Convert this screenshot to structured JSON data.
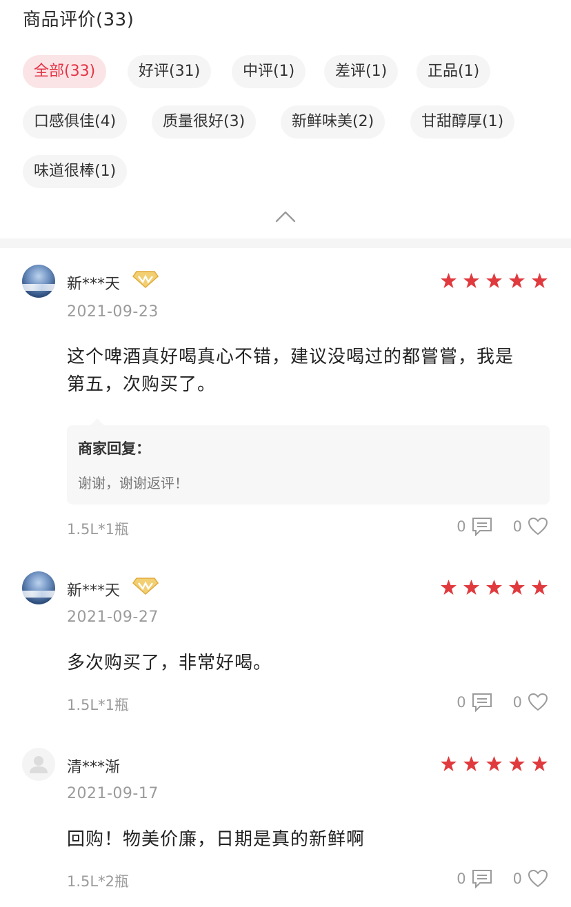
{
  "header": {
    "title": "商品评价(33)"
  },
  "tags": [
    {
      "label": "全部(33)",
      "active": true
    },
    {
      "label": "好评(31)",
      "active": false
    },
    {
      "label": "中评(1)",
      "active": false
    },
    {
      "label": "差评(1)",
      "active": false
    },
    {
      "label": "正品(1)",
      "active": false
    },
    {
      "label": "口感俱佳(4)",
      "active": false
    },
    {
      "label": "质量很好(3)",
      "active": false
    },
    {
      "label": "新鲜味美(2)",
      "active": false
    },
    {
      "label": "甘甜醇厚(1)",
      "active": false
    },
    {
      "label": "味道很棒(1)",
      "active": false
    }
  ],
  "colors": {
    "accent": "#e43345",
    "tag_active_bg": "#fbe4e6",
    "star": "#e03a3e",
    "badge_gold": "#e8b84a"
  },
  "reviews": [
    {
      "username": "新***天",
      "rating": 5,
      "date": "2021-09-23",
      "content_line1": "这个啤酒真好喝真心不错，建议没喝过的都嘗嘗，我是",
      "content_line2": "第五，次购买了。",
      "reply_label": "商家回复：",
      "reply_text": "谢谢，谢谢返评！",
      "spec": "1.5L*1瓶",
      "comment_count": "0",
      "like_count": "0"
    },
    {
      "username": "新***天",
      "rating": 5,
      "date": "2021-09-27",
      "content_line1": "多次购买了，非常好喝。",
      "spec": "1.5L*1瓶",
      "comment_count": "0",
      "like_count": "0"
    },
    {
      "username": "清***渐",
      "rating": 5,
      "date": "2021-09-17",
      "content_line1": "回购！物美价廉，日期是真的新鲜啊",
      "spec": "1.5L*2瓶",
      "comment_count": "0",
      "like_count": "0"
    }
  ]
}
